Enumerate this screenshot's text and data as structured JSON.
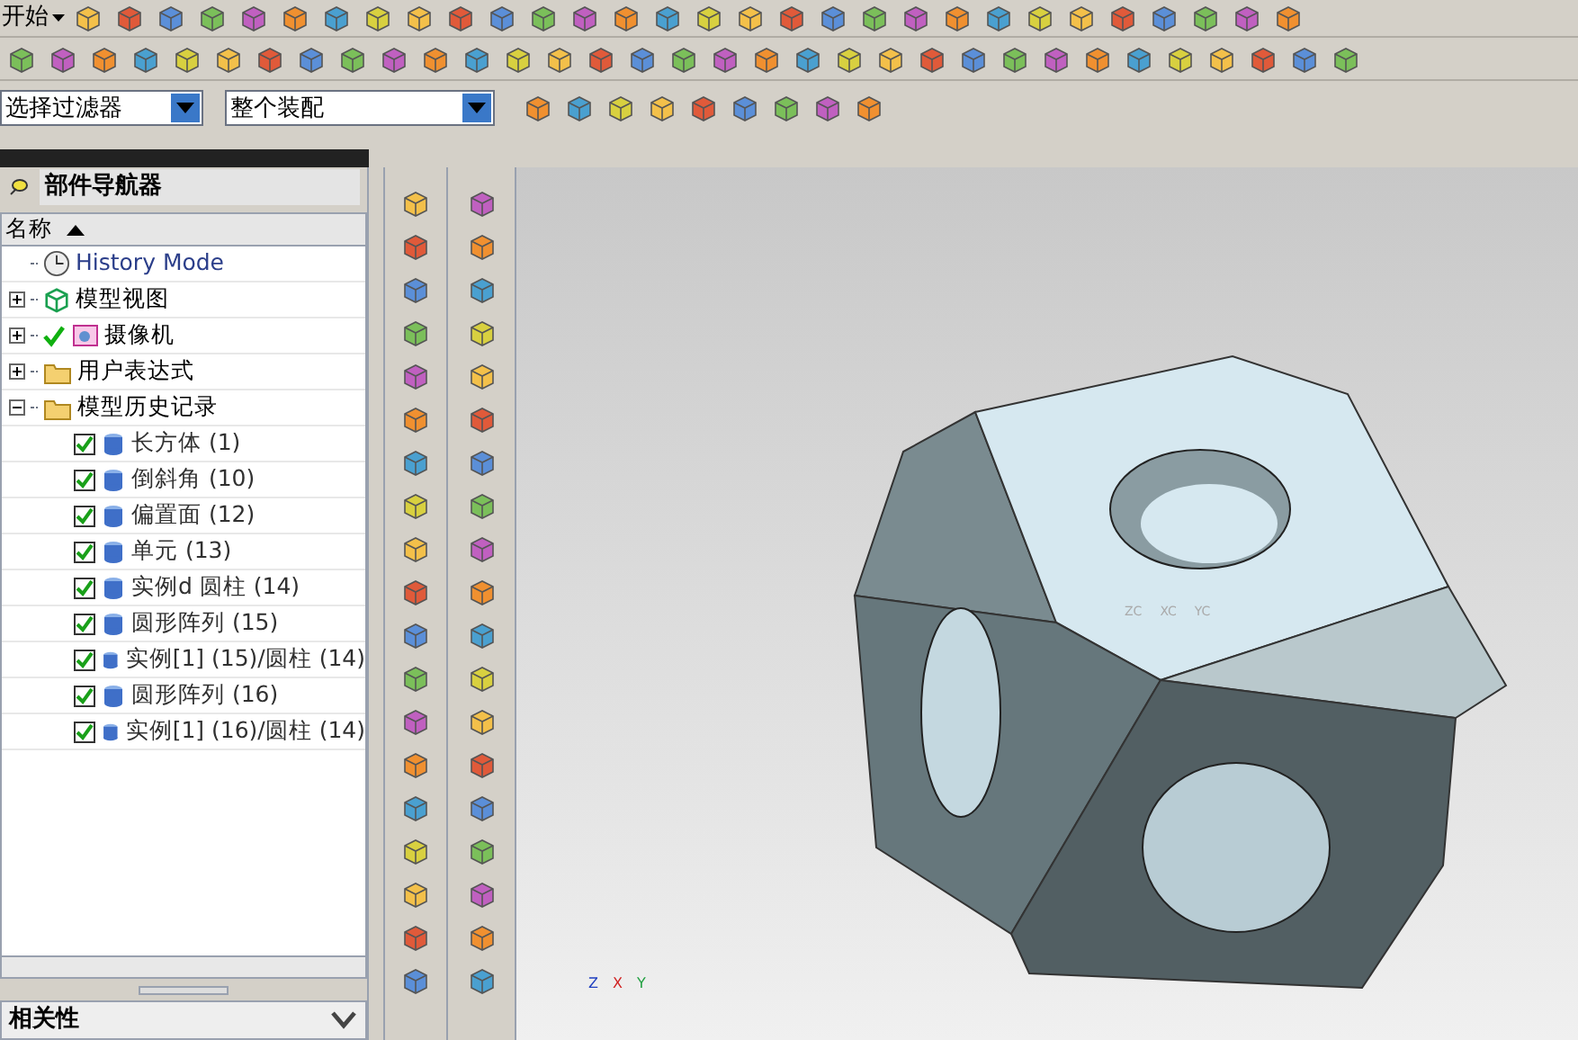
{
  "menu": {
    "start": "开始"
  },
  "filters": [
    {
      "value": "选择过滤器"
    },
    {
      "value": "整个装配"
    }
  ],
  "navigator": {
    "title": "部件导航器",
    "column": "名称",
    "items": [
      {
        "label": "History Mode",
        "kind": "mode"
      },
      {
        "label": "模型视图",
        "kind": "view",
        "expanded": false
      },
      {
        "label": "摄像机",
        "kind": "camera",
        "expanded": false,
        "checked": true
      },
      {
        "label": "用户表达式",
        "kind": "folder",
        "expanded": false
      },
      {
        "label": "模型历史记录",
        "kind": "folder",
        "expanded": true,
        "children": [
          {
            "label": "长方体 (1)",
            "checked": true
          },
          {
            "label": "倒斜角 (10)",
            "checked": true
          },
          {
            "label": "偏置面 (12)",
            "checked": true
          },
          {
            "label": "单元 (13)",
            "checked": true
          },
          {
            "label": "实例d 圆柱 (14)",
            "checked": true
          },
          {
            "label": "圆形阵列 (15)",
            "checked": true
          },
          {
            "label": "实例[1] (15)/圆柱 (14)",
            "checked": true
          },
          {
            "label": "圆形阵列 (16)",
            "checked": true
          },
          {
            "label": "实例[1] (16)/圆柱 (14)",
            "checked": true
          }
        ]
      }
    ]
  },
  "dependency_panel": {
    "title": "相关性",
    "expanded": false
  },
  "viewport": {
    "wcs_axes": [
      "ZC",
      "XC",
      "YC"
    ],
    "triad_axes": [
      "Z",
      "X",
      "Y"
    ]
  }
}
